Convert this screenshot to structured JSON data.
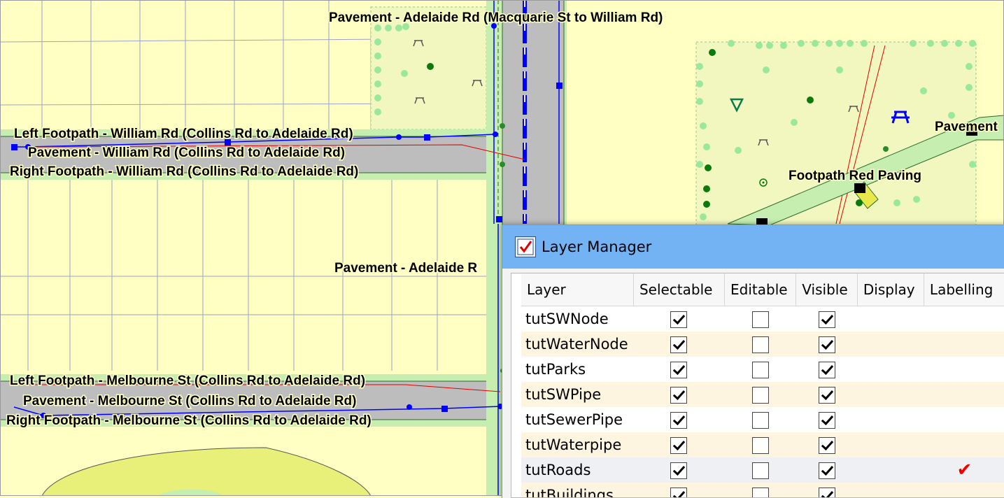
{
  "map": {
    "labels": {
      "pavement_adelaide_top": "Pavement - Adelaide Rd (Macquarie St to William Rd)",
      "left_footpath_william": "Left Footpath - William Rd (Collins Rd to Adelaide Rd)",
      "pavement_william": "Pavement - William Rd (Collins Rd to Adelaide Rd)",
      "right_footpath_william": "Right Footpath - William Rd (Collins Rd to Adelaide Rd)",
      "pavement_adelaide_mid": "Pavement - Adelaide R",
      "left_footpath_melbourne": "Left Footpath - Melbourne St (Collins Rd to Adelaide Rd)",
      "pavement_melbourne": "Pavement - Melbourne St (Collins Rd to Adelaide Rd)",
      "right_footpath_melbourne": "Right Footpath - Melbourne St (Collins Rd to Adelaide Rd)",
      "footpath_red_paving": "Footpath Red Paving",
      "pavement_right_cut": "Pavement"
    },
    "colors": {
      "land": "#ffffc3",
      "park": "#f5f8c8",
      "road": "#bdbdbd",
      "footpath": "#c6eeb0",
      "pipe_blue": "#0000ff",
      "pipe_red": "#e00000",
      "tree": "#9be79b",
      "grass_area": "#e8f07a"
    }
  },
  "layer_manager": {
    "title": "Layer Manager",
    "icon": "checkbox-app-icon",
    "columns": [
      "Layer",
      "Selectable",
      "Editable",
      "Visible",
      "Display",
      "Labelling"
    ],
    "rows": [
      {
        "name": "tutSWNode",
        "selectable": true,
        "editable": false,
        "visible": true,
        "labelling": false
      },
      {
        "name": "tutWaterNode",
        "selectable": true,
        "editable": false,
        "visible": true,
        "labelling": false
      },
      {
        "name": "tutParks",
        "selectable": true,
        "editable": false,
        "visible": true,
        "labelling": false
      },
      {
        "name": "tutSWPipe",
        "selectable": true,
        "editable": false,
        "visible": true,
        "labelling": false
      },
      {
        "name": "tutSewerPipe",
        "selectable": true,
        "editable": false,
        "visible": true,
        "labelling": false
      },
      {
        "name": "tutWaterpipe",
        "selectable": true,
        "editable": false,
        "visible": true,
        "labelling": false
      },
      {
        "name": "tutRoads",
        "selectable": true,
        "editable": false,
        "visible": true,
        "labelling": true
      },
      {
        "name": "tutBuildings",
        "selectable": true,
        "editable": false,
        "visible": true,
        "labelling": false
      }
    ]
  }
}
